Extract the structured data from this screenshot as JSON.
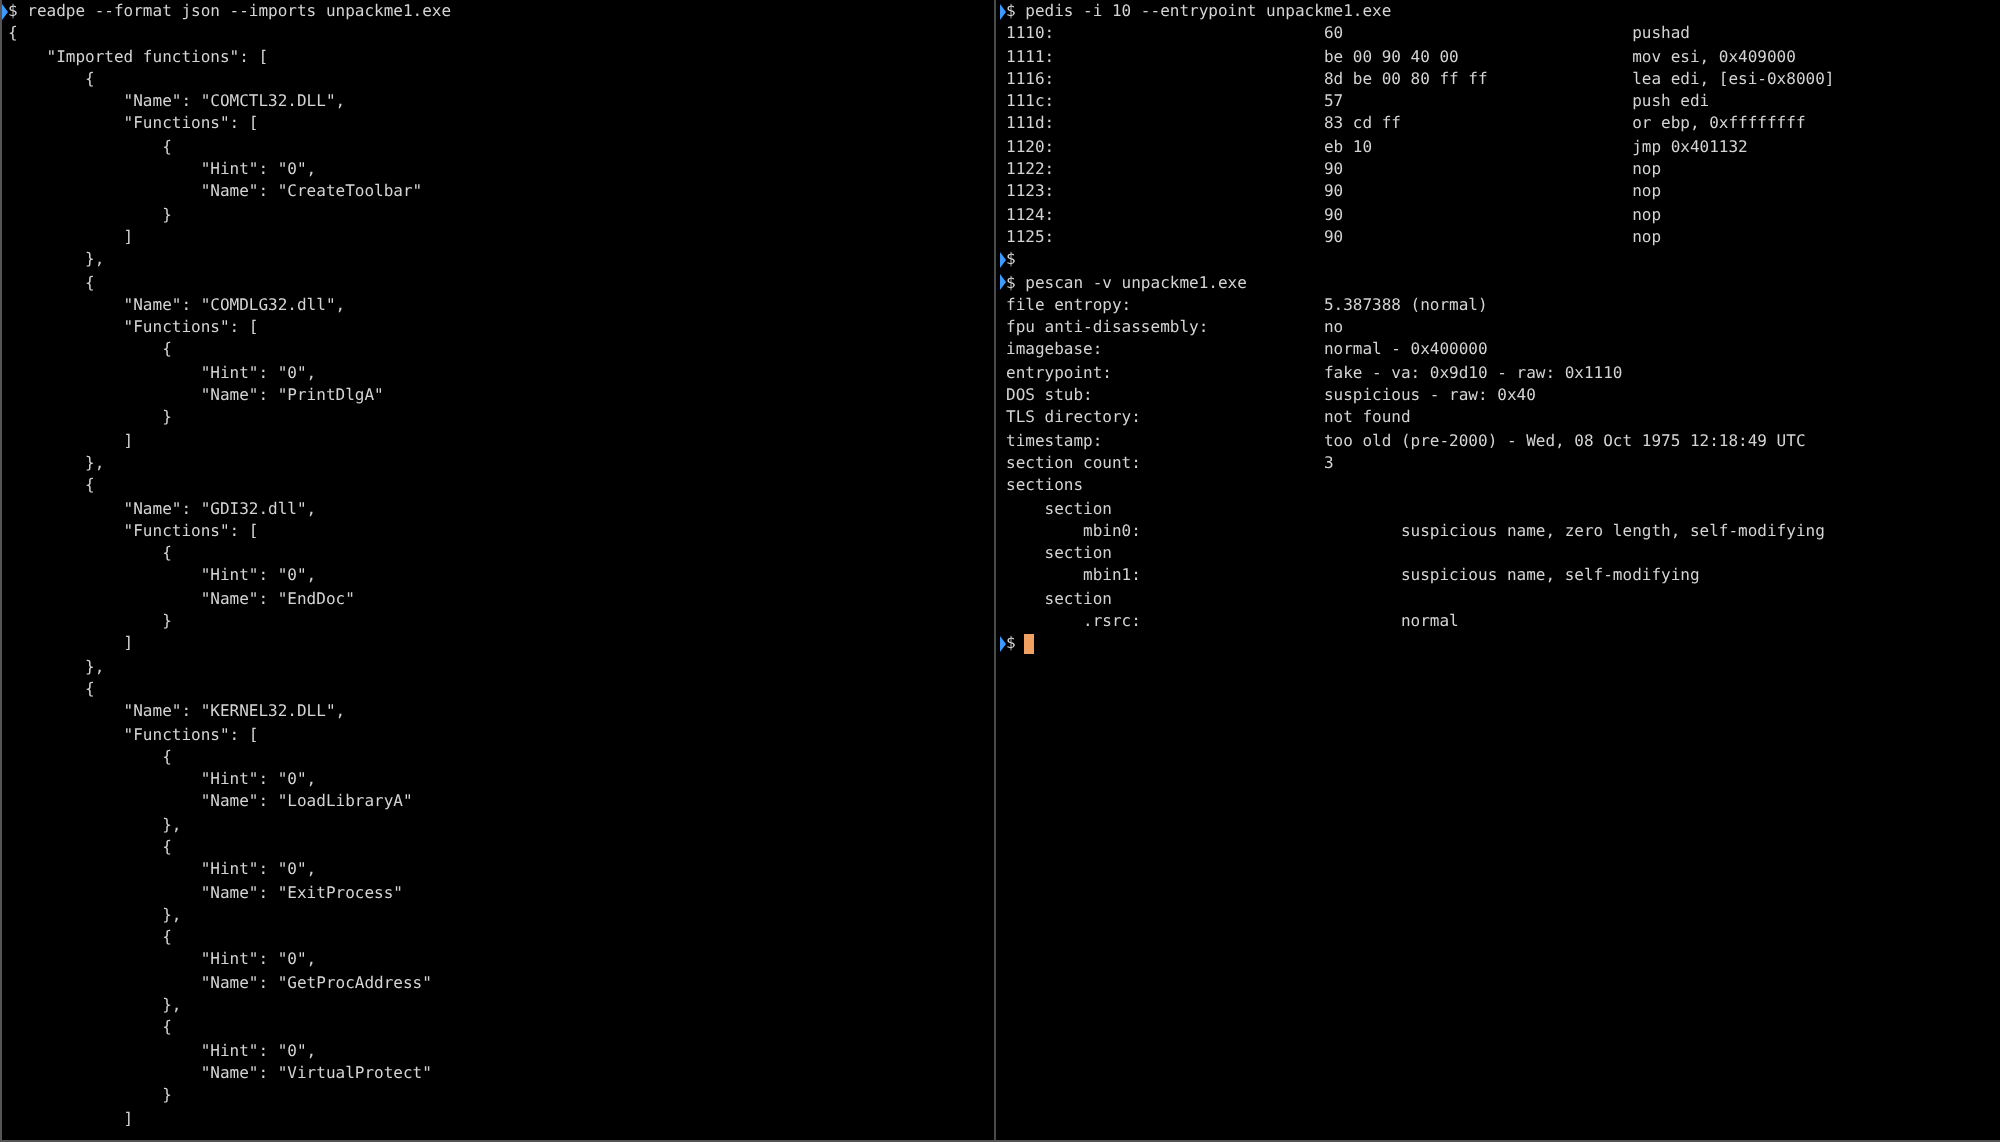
{
  "left_pane": {
    "command": "$ readpe --format json --imports unpackme1.exe",
    "lines": [
      "{",
      "    \"Imported functions\": [",
      "        {",
      "            \"Name\": \"COMCTL32.DLL\",",
      "            \"Functions\": [",
      "                {",
      "                    \"Hint\": \"0\",",
      "                    \"Name\": \"CreateToolbar\"",
      "                }",
      "            ]",
      "        },",
      "        {",
      "            \"Name\": \"COMDLG32.dll\",",
      "            \"Functions\": [",
      "                {",
      "                    \"Hint\": \"0\",",
      "                    \"Name\": \"PrintDlgA\"",
      "                }",
      "            ]",
      "        },",
      "        {",
      "            \"Name\": \"GDI32.dll\",",
      "            \"Functions\": [",
      "                {",
      "                    \"Hint\": \"0\",",
      "                    \"Name\": \"EndDoc\"",
      "                }",
      "            ]",
      "        },",
      "        {",
      "            \"Name\": \"KERNEL32.DLL\",",
      "            \"Functions\": [",
      "                {",
      "                    \"Hint\": \"0\",",
      "                    \"Name\": \"LoadLibraryA\"",
      "                },",
      "                {",
      "                    \"Hint\": \"0\",",
      "                    \"Name\": \"ExitProcess\"",
      "                },",
      "                {",
      "                    \"Hint\": \"0\",",
      "                    \"Name\": \"GetProcAddress\"",
      "                },",
      "                {",
      "                    \"Hint\": \"0\",",
      "                    \"Name\": \"VirtualProtect\"",
      "                }",
      "            ]"
    ]
  },
  "right_pane": {
    "disassembly": {
      "command": "$ pedis -i 10 --entrypoint unpackme1.exe",
      "rows": [
        {
          "address": "1110:",
          "bytes": "60",
          "instruction": "pushad"
        },
        {
          "address": "1111:",
          "bytes": "be 00 90 40 00",
          "instruction": "mov esi, 0x409000"
        },
        {
          "address": "1116:",
          "bytes": "8d be 00 80 ff ff",
          "instruction": "lea edi, [esi-0x8000]"
        },
        {
          "address": "111c:",
          "bytes": "57",
          "instruction": "push edi"
        },
        {
          "address": "111d:",
          "bytes": "83 cd ff",
          "instruction": "or ebp, 0xffffffff"
        },
        {
          "address": "1120:",
          "bytes": "eb 10",
          "instruction": "jmp 0x401132"
        },
        {
          "address": "1122:",
          "bytes": "90",
          "instruction": "nop"
        },
        {
          "address": "1123:",
          "bytes": "90",
          "instruction": "nop"
        },
        {
          "address": "1124:",
          "bytes": "90",
          "instruction": "nop"
        },
        {
          "address": "1125:",
          "bytes": "90",
          "instruction": "nop"
        }
      ],
      "prompt": "$"
    },
    "scan": {
      "command": "$ pescan -v unpackme1.exe",
      "fields": [
        {
          "label": "file entropy:",
          "value": "5.387388 (normal)"
        },
        {
          "label": "fpu anti-disassembly:",
          "value": "no"
        },
        {
          "label": "imagebase:",
          "value": "normal - 0x400000"
        },
        {
          "label": "entrypoint:",
          "value": "fake - va: 0x9d10 - raw: 0x1110"
        },
        {
          "label": "DOS stub:",
          "value": "suspicious - raw: 0x40"
        },
        {
          "label": "TLS directory:",
          "value": "not found"
        },
        {
          "label": "timestamp:",
          "value": "too old (pre-2000) - Wed, 08 Oct 1975 12:18:49 UTC"
        },
        {
          "label": "section count:",
          "value": "3"
        }
      ],
      "sections": {
        "label": "sections",
        "children": [
          {
            "label": "section",
            "children": [
              {
                "label": "mbin0:",
                "value": "suspicious name, zero length, self-modifying"
              }
            ]
          },
          {
            "label": "section",
            "children": [
              {
                "label": "mbin1:",
                "value": "suspicious name, self-modifying"
              }
            ]
          },
          {
            "label": "section",
            "children": [
              {
                "label": ".rsrc:",
                "value": "normal"
              }
            ]
          }
        ]
      },
      "prompt": "$",
      "cursor": true
    }
  }
}
